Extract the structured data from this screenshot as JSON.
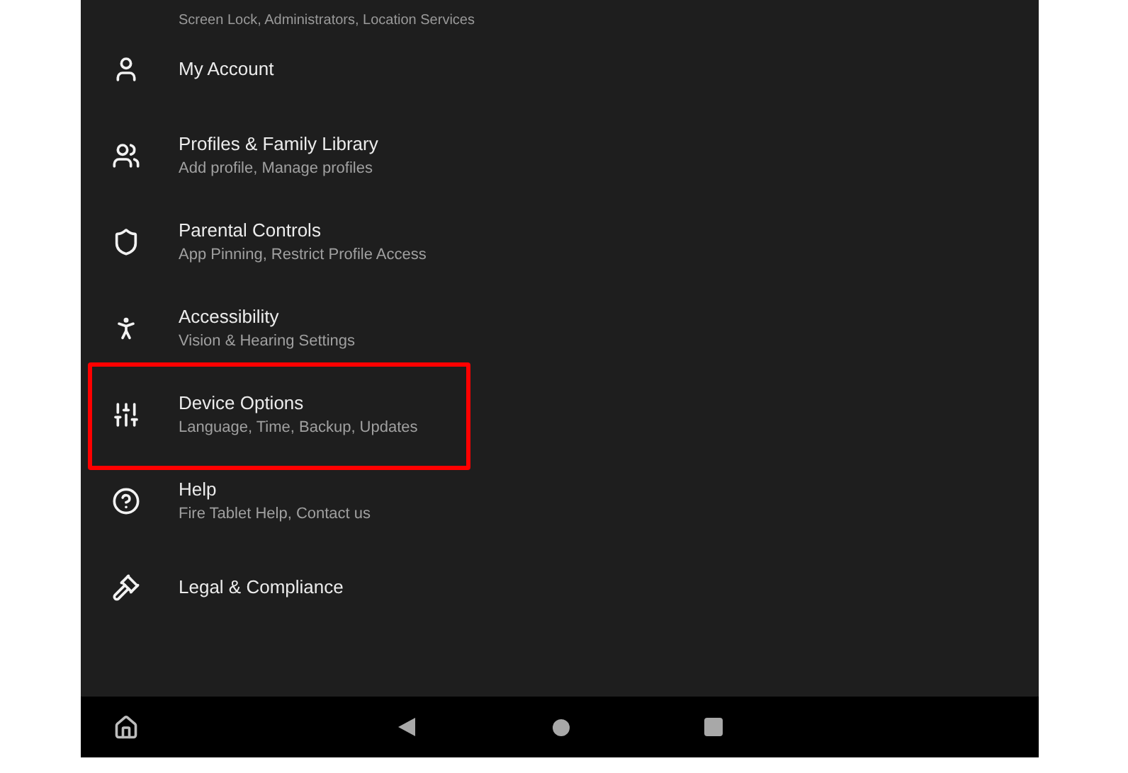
{
  "previous_item_subtitle": "Screen Lock, Administrators, Location Services",
  "settings_items": [
    {
      "title": "My Account",
      "highlighted": false
    },
    {
      "title": "Profiles & Family Library",
      "subtitle": "Add profile, Manage profiles",
      "highlighted": false
    },
    {
      "title": "Parental Controls",
      "subtitle": "App Pinning, Restrict Profile Access",
      "highlighted": false
    },
    {
      "title": "Accessibility",
      "subtitle": "Vision & Hearing Settings",
      "highlighted": false
    },
    {
      "title": "Device Options",
      "subtitle": "Language, Time, Backup, Updates",
      "highlighted": true
    },
    {
      "title": "Help",
      "subtitle": "Fire Tablet Help, Contact us",
      "highlighted": false
    },
    {
      "title": "Legal & Compliance",
      "highlighted": false
    }
  ]
}
